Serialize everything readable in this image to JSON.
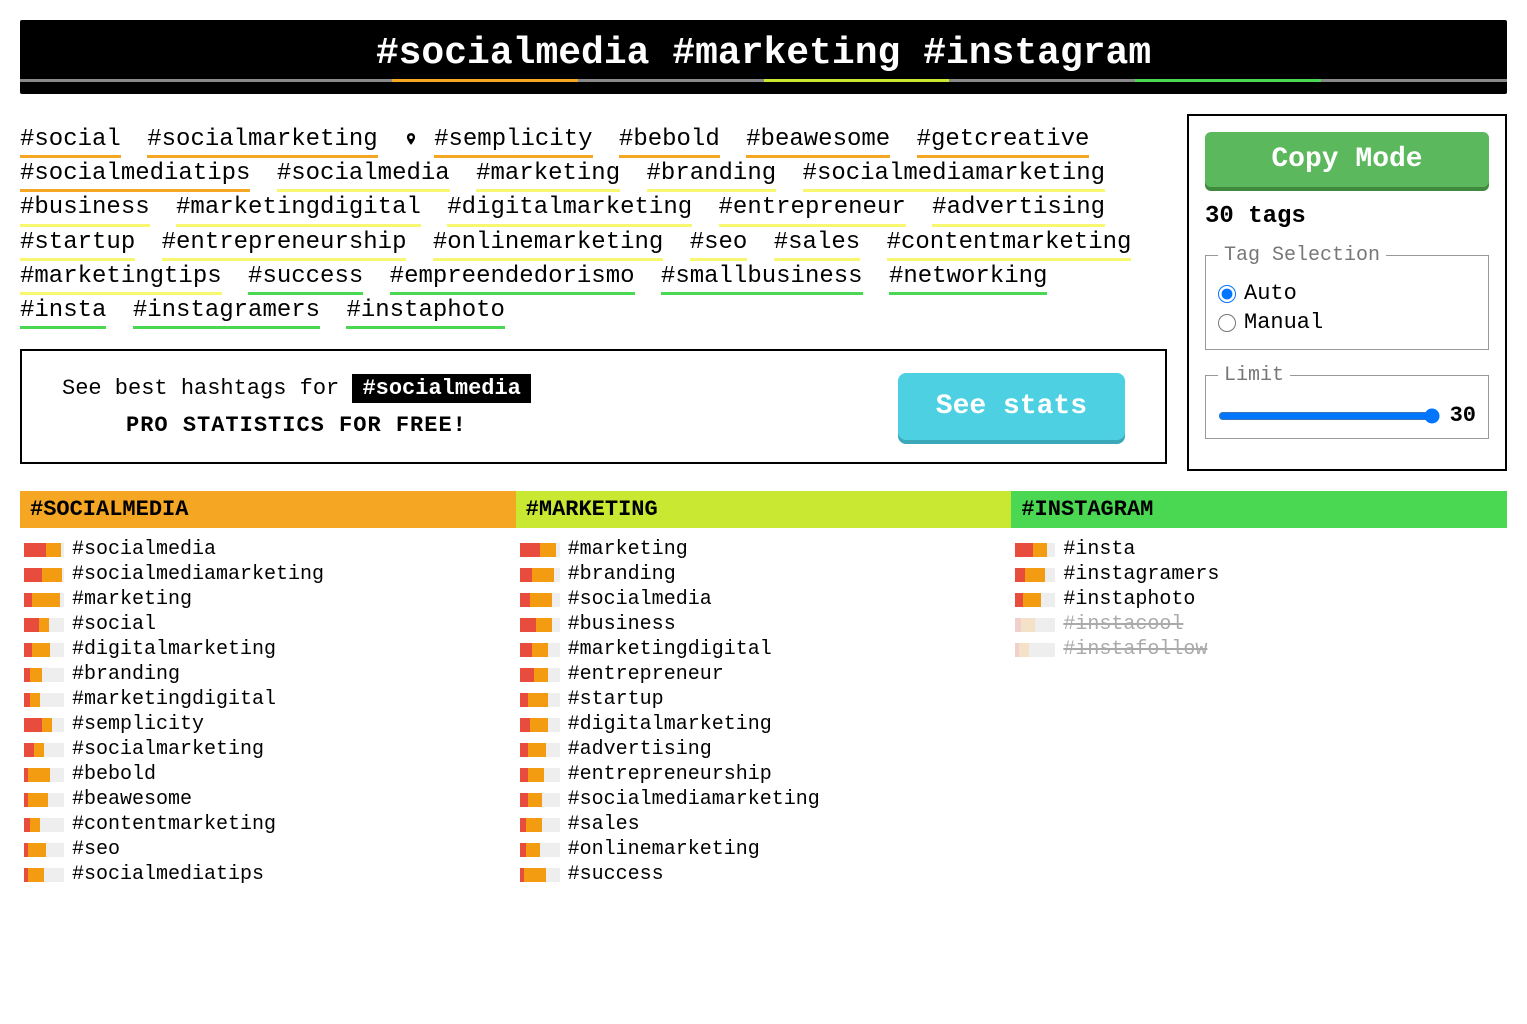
{
  "search": {
    "value": "#socialmedia #marketing #instagram",
    "underline_colors": [
      "#888",
      "#888",
      "#f5a623",
      "#888",
      "#c8e832",
      "#888",
      "#4ad852",
      "#888"
    ]
  },
  "tag_cloud": [
    {
      "t": "#social",
      "c": "o"
    },
    {
      "t": "#socialmarketing",
      "c": "o"
    },
    {
      "t": "#semplicity",
      "c": "o",
      "loc": true
    },
    {
      "t": "#bebold",
      "c": "o"
    },
    {
      "t": "#beawesome",
      "c": "o"
    },
    {
      "t": "#getcreative",
      "c": "o"
    },
    {
      "t": "#socialmediatips",
      "c": "o"
    },
    {
      "t": "#socialmedia",
      "c": "y"
    },
    {
      "t": "#marketing",
      "c": "y"
    },
    {
      "t": "#branding",
      "c": "y"
    },
    {
      "t": "#socialmediamarketing",
      "c": "y"
    },
    {
      "t": "#business",
      "c": "y"
    },
    {
      "t": "#marketingdigital",
      "c": "y"
    },
    {
      "t": "#digitalmarketing",
      "c": "y"
    },
    {
      "t": "#entrepreneur",
      "c": "y"
    },
    {
      "t": "#advertising",
      "c": "y"
    },
    {
      "t": "#startup",
      "c": "y"
    },
    {
      "t": "#entrepreneurship",
      "c": "y"
    },
    {
      "t": "#onlinemarketing",
      "c": "y"
    },
    {
      "t": "#seo",
      "c": "y"
    },
    {
      "t": "#sales",
      "c": "y"
    },
    {
      "t": "#contentmarketing",
      "c": "y"
    },
    {
      "t": "#marketingtips",
      "c": "y"
    },
    {
      "t": "#success",
      "c": "g"
    },
    {
      "t": "#empreendedorismo",
      "c": "g"
    },
    {
      "t": "#smallbusiness",
      "c": "g"
    },
    {
      "t": "#networking",
      "c": "g"
    },
    {
      "t": "#insta",
      "c": "g"
    },
    {
      "t": "#instagramers",
      "c": "g"
    },
    {
      "t": "#instaphoto",
      "c": "g"
    }
  ],
  "stats": {
    "prefix": "See best hashtags for",
    "tag": "#socialmedia",
    "subtitle": "PRO STATISTICS FOR FREE!",
    "button": "See stats"
  },
  "panel": {
    "copy_mode": "Copy Mode",
    "count_label": "30 tags",
    "selection_legend": "Tag Selection",
    "auto_label": "Auto",
    "manual_label": "Manual",
    "selection_value": "auto",
    "limit_legend": "Limit",
    "limit_value": "30",
    "limit_min": "1",
    "limit_max": "30"
  },
  "columns": [
    {
      "header": "#SOCIALMEDIA",
      "hdr_class": "hdr-orange",
      "tags": [
        {
          "t": "#socialmedia",
          "r": 22,
          "o": 15
        },
        {
          "t": "#socialmediamarketing",
          "r": 18,
          "o": 20
        },
        {
          "t": "#marketing",
          "r": 8,
          "o": 28
        },
        {
          "t": "#social",
          "r": 15,
          "o": 10
        },
        {
          "t": "#digitalmarketing",
          "r": 8,
          "o": 18
        },
        {
          "t": "#branding",
          "r": 6,
          "o": 12
        },
        {
          "t": "#marketingdigital",
          "r": 6,
          "o": 10
        },
        {
          "t": "#semplicity",
          "r": 18,
          "o": 10
        },
        {
          "t": "#socialmarketing",
          "r": 10,
          "o": 10
        },
        {
          "t": "#bebold",
          "r": 4,
          "o": 22
        },
        {
          "t": "#beawesome",
          "r": 4,
          "o": 20
        },
        {
          "t": "#contentmarketing",
          "r": 6,
          "o": 10
        },
        {
          "t": "#seo",
          "r": 4,
          "o": 18
        },
        {
          "t": "#socialmediatips",
          "r": 4,
          "o": 16
        }
      ]
    },
    {
      "header": "#MARKETING",
      "hdr_class": "hdr-yellow",
      "tags": [
        {
          "t": "#marketing",
          "r": 20,
          "o": 16
        },
        {
          "t": "#branding",
          "r": 12,
          "o": 22
        },
        {
          "t": "#socialmedia",
          "r": 10,
          "o": 22
        },
        {
          "t": "#business",
          "r": 16,
          "o": 16
        },
        {
          "t": "#marketingdigital",
          "r": 12,
          "o": 16
        },
        {
          "t": "#entrepreneur",
          "r": 14,
          "o": 14
        },
        {
          "t": "#startup",
          "r": 8,
          "o": 20
        },
        {
          "t": "#digitalmarketing",
          "r": 10,
          "o": 18
        },
        {
          "t": "#advertising",
          "r": 8,
          "o": 18
        },
        {
          "t": "#entrepreneurship",
          "r": 8,
          "o": 16
        },
        {
          "t": "#socialmediamarketing",
          "r": 8,
          "o": 14
        },
        {
          "t": "#sales",
          "r": 6,
          "o": 16
        },
        {
          "t": "#onlinemarketing",
          "r": 6,
          "o": 14
        },
        {
          "t": "#success",
          "r": 4,
          "o": 22
        }
      ]
    },
    {
      "header": "#INSTAGRAM",
      "hdr_class": "hdr-green",
      "tags": [
        {
          "t": "#insta",
          "r": 18,
          "o": 14
        },
        {
          "t": "#instagramers",
          "r": 10,
          "o": 20
        },
        {
          "t": "#instaphoto",
          "r": 8,
          "o": 18
        },
        {
          "t": "#instacool",
          "r": 6,
          "o": 14,
          "disabled": true
        },
        {
          "t": "#instafollow",
          "r": 4,
          "o": 10,
          "disabled": true
        }
      ]
    }
  ]
}
